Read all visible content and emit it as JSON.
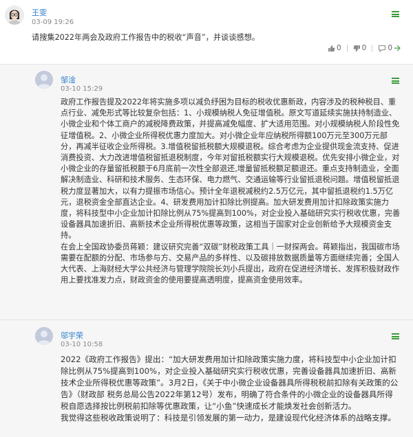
{
  "post": {
    "author": "王雯",
    "time": "03-09 19:26",
    "text": "请搜集2022年两会及政府工作报告中的税收“声音”，并谈谈感想。",
    "likes": "0",
    "dislikes": "0",
    "comments": "0"
  },
  "replies": [
    {
      "author": "邹淦",
      "time": "03-10 15:29",
      "text": "政府工作报告提及2022年将实施多项以减负纾困为目标的税收优惠新政，内容涉及的税种税目、重点行业、减免形式等比较复杂包括：1、小规模纳税人免征增值税。原文写道延续实施扶持制造业、小微企业和个体工商户的减税降费政策，并提高减免幅度、扩大适用范围。对小规模纳税人阶段性免征增值税。2、小微企业所得税优惠力度加大。对小微企业年应纳税所得额100万元至300万元部分，再减半征收企业所得税。3.增值税留抵税额大规模退税。综合考虑为企业提供现金流支持、促进消费投资、大力改进增值税留抵退税制度，今年对留抵税额实行大规模退税。优先安排小微企业，对小微企业的存量留抵税额于6月底前一次性全部退还,增量留抵税额足额退还。重点支持制造业，全面解决制造业、科研和技术服务、生态环保、电力燃气、交通运输等行业留抵退税问题。增值税留抵退税力度显著加大，以有力提振市场信心。预计全年退税减税约2.5万亿元，其中留抵退税约1.5万亿元，退税资金全部直达企业。4、研发费用加计扣除比例提高。加大研发费用加计扣除政策实施力度，将科技型中小企业加计扣除比例从75%提高到100%，对企业投入基础研究实行税收优惠，完善设备器具加速折旧、高新技术企业所得税优惠等政策，这相当于国家对企业创新给予大规模资金支持。\n在会上全国政协委员蒋颖：建议研究完善“双碳”财税政策工具｜一财探两会。蒋颖指出，我国碳市场需要在配额的分配、市场参与方、交易产品的多样性、以及碳排放数据质量等方面继续完善；全国人大代表、上海财经大学公共经济与管理学院院长刘小兵提出，政府在促进经济增长、发挥积极财政作用上要找准发力点，财政资金的使用要提高透明度，提高资金使用效率。"
    },
    {
      "author": "邬宇荣",
      "time": "03-10 10:58",
      "text": "2022《政府工作报告》提出：“加大研发费用加计扣除政策实施力度，将科技型中小企业加计扣除比例从75%提高到100%，对企业投入基础研究实行税收优惠，完善设备器具加速折旧、高新技术企业所得税优惠等政策”。3月2日，《关于中小微企业设备器具所得税税前扣除有关政策的公告》（财政部 税务总局公告2022年第12号）发布，明确了符合条件的小微企业的设备器具所得税自愿选择按比例税前扣除等优惠政策，让“小鱼”快速成长才能焕发社会创新活力。\n我觉得这些税收政策说明了：科技是引领发展的第一动力，是建设现代化经济体系的战略支撑。"
    }
  ],
  "colors": {
    "name": "#2f7fce",
    "menu": "#3a9a3a",
    "reply_bg": "#f6f6f6"
  },
  "icons": [
    "menu-icon",
    "thumb-up-icon",
    "thumb-down-icon",
    "comment-icon",
    "avatar"
  ]
}
